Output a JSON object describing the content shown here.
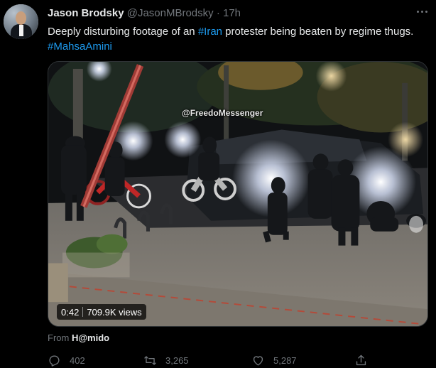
{
  "tweet": {
    "author_name": "Jason Brodsky",
    "author_handle": "@JasonMBrodsky",
    "separator": "·",
    "time": "17h",
    "text_parts": {
      "p1": "Deeply disturbing footage of an ",
      "hashtag1": "#Iran",
      "p2": " protester being beaten by regime thugs. ",
      "hashtag2": "#MahsaAmini"
    },
    "video": {
      "watermark": "@FreedoMessenger",
      "duration": "0:42",
      "views": "709.9K views"
    },
    "from_label": "From",
    "from_name": "H@mido",
    "actions": {
      "replies": "402",
      "retweets": "3,265",
      "likes": "5,287"
    }
  },
  "colors": {
    "background": "#000000",
    "text": "#e7e9ea",
    "secondary": "#71767b",
    "link": "#1d9bf0"
  },
  "icons": [
    "more-icon",
    "reply-icon",
    "retweet-icon",
    "like-icon",
    "share-icon"
  ]
}
